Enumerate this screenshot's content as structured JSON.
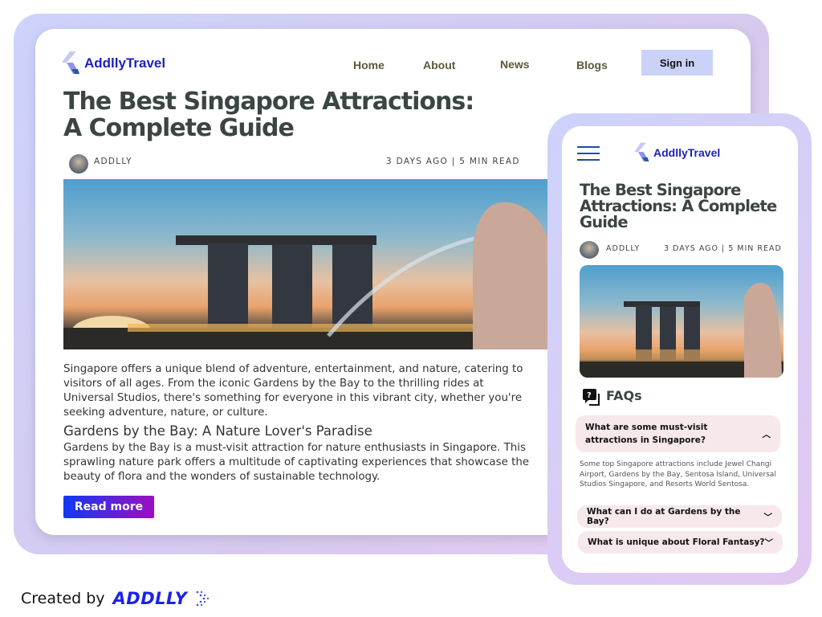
{
  "brand": {
    "name": "AddllyTravel",
    "accent": "#1c1fbf"
  },
  "nav": {
    "items": [
      "Home",
      "About",
      "News",
      "Blogs"
    ],
    "signin": "Sign in"
  },
  "article": {
    "title_line1": "The Best Singapore Attractions:",
    "title_line2": "A Complete Guide",
    "author": "ADDLLY",
    "meta": "3 DAYS AGO | 5 MIN READ",
    "intro": "Singapore offers a unique blend of adventure, entertainment, and nature, catering to visitors of all ages. From the iconic Gardens by the Bay to the thrilling rides at Universal Studios, there's something for everyone in this vibrant city, whether you're seeking adventure, nature, or culture.",
    "section_title": "Gardens by the Bay: A Nature Lover's Paradise",
    "section_body": "Gardens by the Bay is a must-visit attraction for nature enthusiasts in Singapore. This sprawling nature park offers a multitude of captivating experiences that showcase the beauty of flora and the wonders of sustainable technology.",
    "read_more": "Read more"
  },
  "mobile": {
    "title": "The Best Singapore Attractions: A Complete Guide",
    "author": "ADDLLY",
    "meta": "3 DAYS AGO | 5 MIN READ",
    "faq_title": "FAQs",
    "faqs": [
      {
        "q": "What are some must-visit attractions in Singapore?",
        "a": "Some top Singapore attractions include Jewel Changi Airport, Gardens by the Bay, Sentosa Island, Universal Studios Singapore, and Resorts World Sentosa.",
        "expanded": true
      },
      {
        "q": "What can I do at Gardens by the Bay?",
        "expanded": false
      },
      {
        "q": "What is unique about Floral Fantasy?",
        "expanded": false
      }
    ]
  },
  "footer": {
    "created_by": "Created by",
    "brand": "ADDLLY"
  }
}
